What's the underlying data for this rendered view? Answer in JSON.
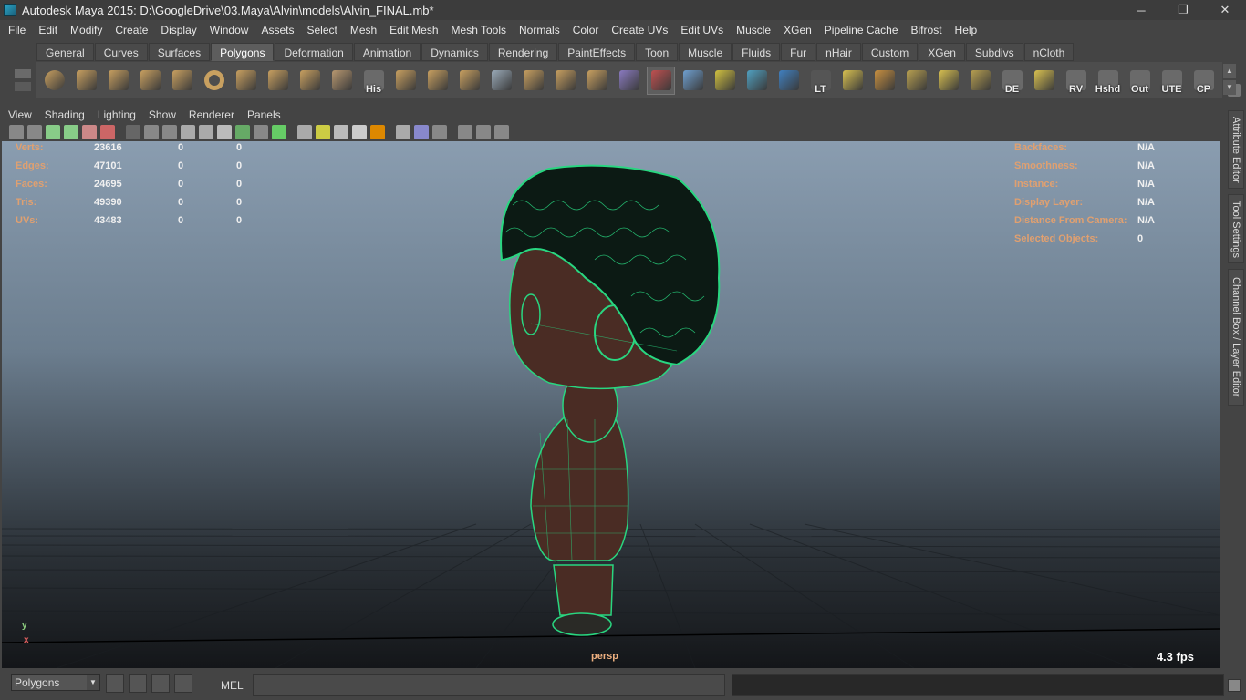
{
  "window": {
    "title": "Autodesk Maya 2015: D:\\GoogleDrive\\03.Maya\\Alvin\\models\\Alvin_FINAL.mb*",
    "minimize": "─",
    "restore": "❐",
    "close": "✕"
  },
  "menubar": [
    "File",
    "Edit",
    "Modify",
    "Create",
    "Display",
    "Window",
    "Assets",
    "Select",
    "Mesh",
    "Edit Mesh",
    "Mesh Tools",
    "Normals",
    "Color",
    "Create UVs",
    "Edit UVs",
    "Muscle",
    "XGen",
    "Pipeline Cache",
    "Bifrost",
    "Help"
  ],
  "shelf_tabs": [
    "General",
    "Curves",
    "Surfaces",
    "Polygons",
    "Deformation",
    "Animation",
    "Dynamics",
    "Rendering",
    "PaintEffects",
    "Toon",
    "Muscle",
    "Fluids",
    "Fur",
    "nHair",
    "Custom",
    "XGen",
    "Subdivs",
    "nCloth"
  ],
  "active_shelf_tab": "Polygons",
  "shelf_icons": [
    {
      "name": "poly-sphere-icon",
      "color": "#c8a060",
      "label": ""
    },
    {
      "name": "poly-cube-icon",
      "color": "#c8a060",
      "label": ""
    },
    {
      "name": "poly-cylinder-icon",
      "color": "#c8a060",
      "label": ""
    },
    {
      "name": "poly-cone-icon",
      "color": "#c8a060",
      "label": ""
    },
    {
      "name": "poly-plane-icon",
      "color": "#c8a060",
      "label": ""
    },
    {
      "name": "poly-torus-icon",
      "color": "#c8a060",
      "label": ""
    },
    {
      "name": "poly-pyramid-icon",
      "color": "#c8a060",
      "label": ""
    },
    {
      "name": "poly-pipe-icon",
      "color": "#c8a060",
      "label": ""
    },
    {
      "name": "create-polygon-tool-icon",
      "color": "#c8a060",
      "label": ""
    },
    {
      "name": "poly-soccerball-icon",
      "color": "#b89870",
      "label": ""
    },
    {
      "name": "history-icon",
      "color": "#f0f0f0",
      "label": "His"
    },
    {
      "name": "extrude-icon",
      "color": "#c8a060",
      "label": ""
    },
    {
      "name": "bridge-icon",
      "color": "#c8a060",
      "label": ""
    },
    {
      "name": "append-polygon-icon",
      "color": "#c8a060",
      "label": ""
    },
    {
      "name": "split-polygon-icon",
      "color": "#9aaab8",
      "label": ""
    },
    {
      "name": "insert-edge-loop-icon",
      "color": "#c8a060",
      "label": ""
    },
    {
      "name": "merge-vertices-icon",
      "color": "#c8a060",
      "label": ""
    },
    {
      "name": "combine-icon",
      "color": "#c8a060",
      "label": ""
    },
    {
      "name": "mirror-geometry-icon",
      "color": "#8a7ac0",
      "label": ""
    },
    {
      "name": "sculpt-tool-icon",
      "color": "#c05050",
      "label": ""
    },
    {
      "name": "lattice-icon",
      "color": "#6fa0d0",
      "label": ""
    },
    {
      "name": "soft-modification-icon",
      "color": "#d0c040",
      "label": ""
    },
    {
      "name": "transform-component-icon",
      "color": "#50a0c0",
      "label": ""
    },
    {
      "name": "planar-mapping-icon",
      "color": "#4080c0",
      "label": ""
    },
    {
      "name": "lt-icon",
      "color": "#555555",
      "label": "LT"
    },
    {
      "name": "uv-layout-1-icon",
      "color": "#d8c050",
      "label": ""
    },
    {
      "name": "uv-layout-2-icon",
      "color": "#c89040",
      "label": ""
    },
    {
      "name": "uv-layout-3-icon",
      "color": "#b8a050",
      "label": ""
    },
    {
      "name": "uv-layout-4-icon",
      "color": "#d8c050",
      "label": ""
    },
    {
      "name": "uv-layout-5-icon",
      "color": "#b8a050",
      "label": ""
    },
    {
      "name": "de-icon",
      "color": "#d8c050",
      "label": "DE"
    },
    {
      "name": "uv-editor-icon",
      "color": "#d8c050",
      "label": ""
    },
    {
      "name": "rv-icon",
      "color": "#e0e0e0",
      "label": "RV"
    },
    {
      "name": "hshd-icon",
      "color": "#e0e0e0",
      "label": "Hshd"
    },
    {
      "name": "out-icon",
      "color": "#e0e0e0",
      "label": "Out"
    },
    {
      "name": "ute-icon",
      "color": "#e0e0e0",
      "label": "UTE"
    },
    {
      "name": "cp-icon",
      "color": "#60c060",
      "label": "CP"
    }
  ],
  "viewport_menu": [
    "View",
    "Shading",
    "Lighting",
    "Show",
    "Renderer",
    "Panels"
  ],
  "hud_left": [
    {
      "label": "Verts:",
      "v1": "23616",
      "v2": "0",
      "v3": "0"
    },
    {
      "label": "Edges:",
      "v1": "47101",
      "v2": "0",
      "v3": "0"
    },
    {
      "label": "Faces:",
      "v1": "24695",
      "v2": "0",
      "v3": "0"
    },
    {
      "label": "Tris:",
      "v1": "49390",
      "v2": "0",
      "v3": "0"
    },
    {
      "label": "UVs:",
      "v1": "43483",
      "v2": "0",
      "v3": "0"
    }
  ],
  "hud_right": [
    {
      "label": "Backfaces:",
      "value": "N/A"
    },
    {
      "label": "Smoothness:",
      "value": "N/A"
    },
    {
      "label": "Instance:",
      "value": "N/A"
    },
    {
      "label": "Display Layer:",
      "value": "N/A"
    },
    {
      "label": "Distance From Camera:",
      "value": "N/A"
    },
    {
      "label": "Selected Objects:",
      "value": "0"
    }
  ],
  "camera_name": "persp",
  "fps": "4.3 fps",
  "axis": {
    "y": "y",
    "x": "x"
  },
  "side_tabs": [
    "Attribute Editor",
    "Tool Settings",
    "Channel Box / Layer Editor"
  ],
  "bottom": {
    "mode": "Polygons",
    "mel": "MEL"
  },
  "colors": {
    "hair": "#0c1a14",
    "wire": "#29d680",
    "skin": "#4a2c24"
  }
}
